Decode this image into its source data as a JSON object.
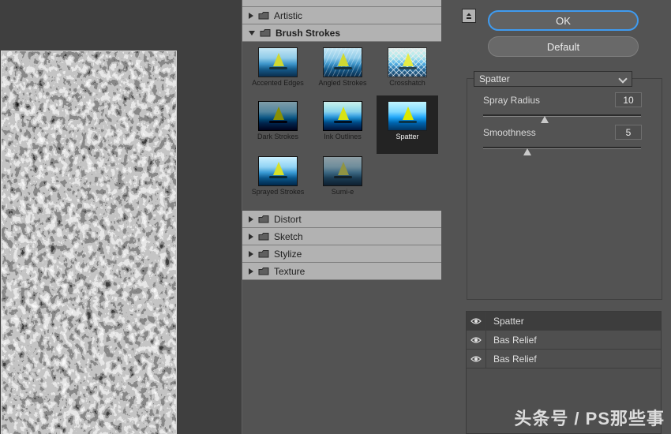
{
  "filter_list": {
    "categories": [
      {
        "label": "Artistic",
        "expanded": false
      },
      {
        "label": "Brush Strokes",
        "expanded": true
      },
      {
        "label": "Distort",
        "expanded": false
      },
      {
        "label": "Sketch",
        "expanded": false
      },
      {
        "label": "Stylize",
        "expanded": false
      },
      {
        "label": "Texture",
        "expanded": false
      }
    ],
    "brush_strokes_filters": [
      "Accented Edges",
      "Angled Strokes",
      "Crosshatch",
      "Dark Strokes",
      "Ink Outlines",
      "Spatter",
      "Sprayed Strokes",
      "Sumi-e"
    ],
    "selected_filter": "Spatter"
  },
  "controls": {
    "ok_label": "OK",
    "default_label": "Default",
    "filter_select": {
      "value": "Spatter"
    },
    "sliders": [
      {
        "label": "Spray Radius",
        "value": 10
      },
      {
        "label": "Smoothness",
        "value": 5
      }
    ]
  },
  "effect_layers": {
    "rows": [
      {
        "name": "Spatter",
        "visible": true,
        "selected": true
      },
      {
        "name": "Bas Relief",
        "visible": true,
        "selected": false
      },
      {
        "name": "Bas Relief",
        "visible": true,
        "selected": false
      }
    ]
  },
  "colors": {
    "accent_blue": "#3f9bf0",
    "panel_gray": "#535353",
    "row_gray": "#b2b2b2"
  },
  "watermark": "头条号 / PS那些事"
}
